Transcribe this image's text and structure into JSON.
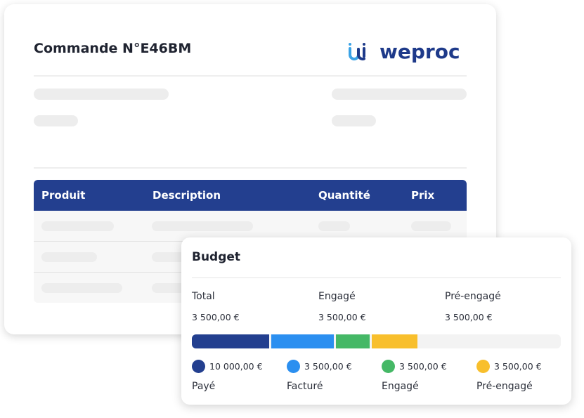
{
  "order": {
    "title": "Commande N°E46BM",
    "brand": "weproc",
    "colors": {
      "brand_blue": "#1e3a8a",
      "brand_light": "#3ba3e6",
      "table_header": "#233f8f"
    },
    "table": {
      "headers": [
        "Produit",
        "Description",
        "Quantité",
        "Prix"
      ]
    }
  },
  "budget": {
    "title": "Budget",
    "columns": [
      {
        "label": "Total",
        "value": "3 500,00 €"
      },
      {
        "label": "Engagé",
        "value": "3 500,00 €"
      },
      {
        "label": "Pré-engagé",
        "value": "3 500,00 €"
      }
    ],
    "bar": [
      {
        "label": "Payé",
        "fraction": 0.215,
        "color": "#233f8f"
      },
      {
        "label": "Facturé",
        "fraction": 0.175,
        "color": "#2b8ff0"
      },
      {
        "label": "Engagé",
        "fraction": 0.098,
        "color": "#45b866"
      },
      {
        "label": "Pré-engagé",
        "fraction": 0.13,
        "color": "#f8bf2c"
      }
    ],
    "legend": [
      {
        "value": "10 000,00 €",
        "label": "Payé",
        "color": "#233f8f"
      },
      {
        "value": "3 500,00 €",
        "label": "Facturé",
        "color": "#2b8ff0"
      },
      {
        "value": "3 500,00 €",
        "label": "Engagé",
        "color": "#45b866"
      },
      {
        "value": "3 500,00 €",
        "label": "Pré-engagé",
        "color": "#f8bf2c"
      }
    ]
  }
}
